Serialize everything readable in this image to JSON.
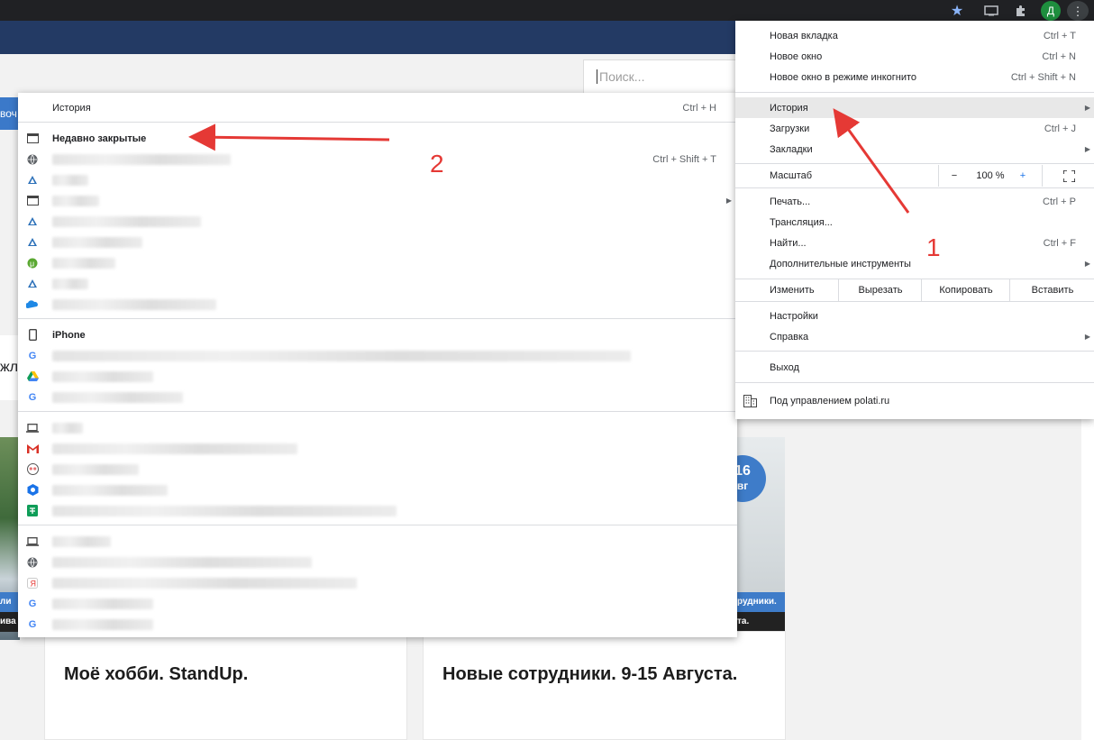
{
  "toolbar": {
    "profile_initial": "Д",
    "icons": [
      "bookmark-star-icon",
      "cast-icon",
      "extensions-icon",
      "profile-avatar",
      "menu-kebab-icon"
    ]
  },
  "page": {
    "search_placeholder": "Поиск...",
    "blue_button_partial": "воч",
    "left_partial_text": "жл",
    "card_left_title": "Моё хобби. StandUp.",
    "card_right_title": "Новые сотрудники. 9-15 Августа.",
    "date_day": "16",
    "date_month": "вг",
    "right_caption_line1": "рудники.",
    "right_caption_line2": "та.",
    "left_caption_line1": "ли",
    "left_caption_line2": "ива"
  },
  "chrome_menu": {
    "new_tab": {
      "label": "Новая вкладка",
      "shortcut": "Ctrl + T"
    },
    "new_window": {
      "label": "Новое окно",
      "shortcut": "Ctrl + N"
    },
    "incognito": {
      "label": "Новое окно в режиме инкогнито",
      "shortcut": "Ctrl + Shift + N"
    },
    "history": {
      "label": "История"
    },
    "downloads": {
      "label": "Загрузки",
      "shortcut": "Ctrl + J"
    },
    "bookmarks": {
      "label": "Закладки"
    },
    "zoom": {
      "label": "Масштаб",
      "minus": "−",
      "value": "100 %",
      "plus": "+"
    },
    "print": {
      "label": "Печать...",
      "shortcut": "Ctrl + P"
    },
    "cast": {
      "label": "Трансляция..."
    },
    "find": {
      "label": "Найти...",
      "shortcut": "Ctrl + F"
    },
    "more_tools": {
      "label": "Дополнительные инструменты"
    },
    "edit": {
      "label": "Изменить",
      "cut": "Вырезать",
      "copy": "Копировать",
      "paste": "Вставить"
    },
    "settings": {
      "label": "Настройки"
    },
    "help": {
      "label": "Справка"
    },
    "exit": {
      "label": "Выход"
    },
    "managed": {
      "label": "Под управлением polati.ru"
    }
  },
  "history_menu": {
    "history": {
      "label": "История",
      "shortcut": "Ctrl + H"
    },
    "recently_closed": {
      "label": "Недавно закрытые"
    },
    "first_entry_shortcut": "Ctrl + Shift + T",
    "device1": {
      "label": "iPhone"
    }
  },
  "annotations": {
    "label1": "1",
    "label2": "2",
    "color": "#e53935"
  }
}
